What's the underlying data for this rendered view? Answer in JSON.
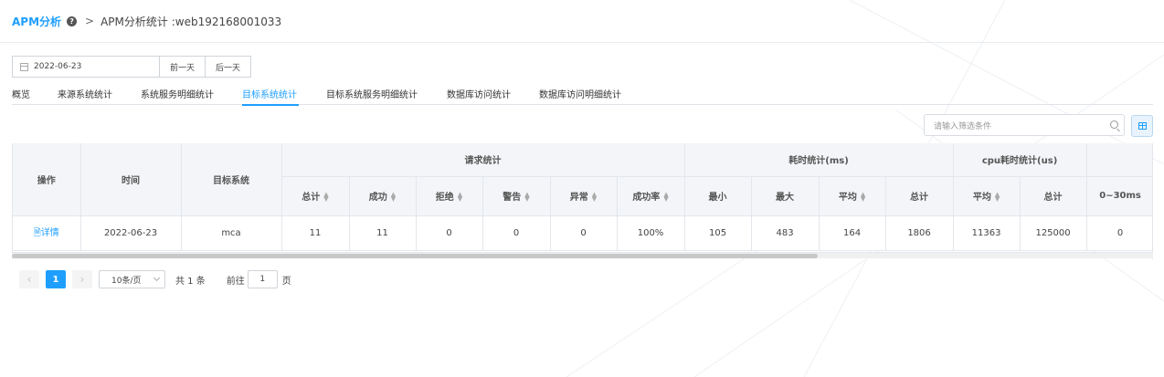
{
  "breadcrumb": {
    "root": "APM分析",
    "help_icon": "question-circle-icon",
    "separator": ">",
    "current": "APM分析统计 :web192168001033"
  },
  "datebar": {
    "date": "2022-06-23",
    "prev_label": "前一天",
    "next_label": "后一天"
  },
  "tabs": [
    {
      "label": "概览",
      "active": false
    },
    {
      "label": "来源系统统计",
      "active": false
    },
    {
      "label": "系统服务明细统计",
      "active": false
    },
    {
      "label": "目标系统统计",
      "active": true
    },
    {
      "label": "目标系统服务明细统计",
      "active": false
    },
    {
      "label": "数据库访问统计",
      "active": false
    },
    {
      "label": "数据库访问明细统计",
      "active": false
    }
  ],
  "filter": {
    "placeholder": "请输入筛选条件"
  },
  "table": {
    "columns": {
      "op": "操作",
      "time": "时间",
      "target": "目标系统",
      "group_requests": "请求统计",
      "group_cost": "耗时统计(ms)",
      "group_cpu": "cpu耗时统计(us)",
      "total": "总计",
      "success": "成功",
      "reject": "拒绝",
      "warn": "警告",
      "error": "异常",
      "success_rate": "成功率",
      "min": "最小",
      "max": "最大",
      "avg": "平均",
      "cost_total": "总计",
      "cpu_avg": "平均",
      "cpu_total": "总计",
      "range_0_30": "0~30ms"
    },
    "rows": [
      {
        "op": "详情",
        "time": "2022-06-23",
        "target": "mca",
        "total": "11",
        "success": "11",
        "reject": "0",
        "warn": "0",
        "error": "0",
        "success_rate": "100%",
        "min": "105",
        "max": "483",
        "avg": "164",
        "cost_total": "1806",
        "cpu_avg": "11363",
        "cpu_total": "125000",
        "range_0_30": "0"
      }
    ]
  },
  "pagination": {
    "prev": "‹",
    "current_page": "1",
    "next": "›",
    "page_size": "10条/页",
    "total": "共 1 条",
    "goto_prefix": "前往",
    "goto_value": "1",
    "goto_suffix": "页"
  },
  "colors": {
    "accent": "#1e9fff",
    "header_bg": "#f3f5f8",
    "border": "#e3e6eb"
  }
}
